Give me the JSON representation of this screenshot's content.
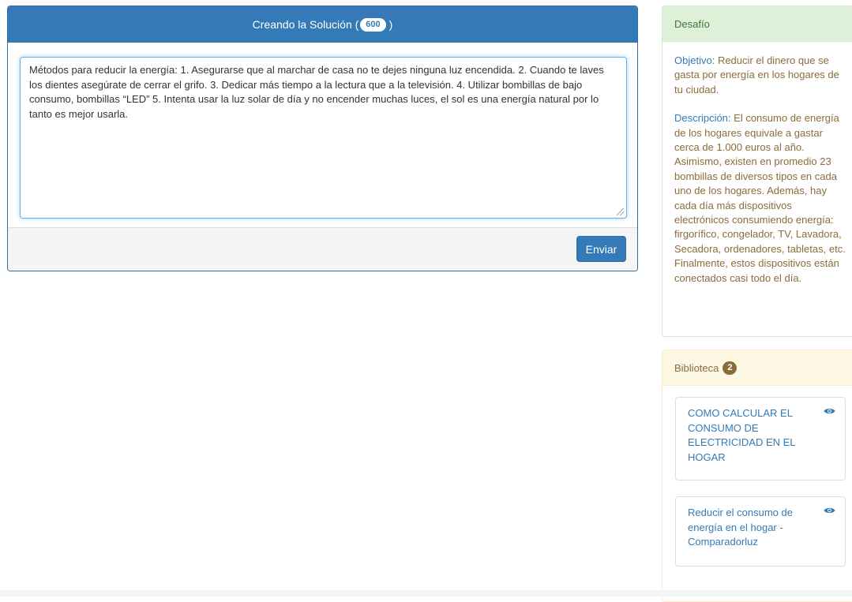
{
  "solution": {
    "header_prefix": "Creando la Solución (",
    "char_count": "600",
    "header_suffix": ")",
    "text": "Métodos para reducir la energía: 1. Asegurarse que al marchar de casa no te dejes ninguna luz encendida. 2. Cuando te laves los dientes asegúrate de cerrar el grifo. 3. Dedicar más tiempo a la lectura que a la televisión. 4. Utilizar bombillas de bajo consumo, bombillas “LED” 5. Intenta usar la luz solar de día y no encender muchas luces, el sol es una energía natural por lo tanto es mejor usarla.",
    "submit_label": "Enviar"
  },
  "challenge": {
    "title": "Desafío",
    "objective_label": "Objetivo:",
    "objective_text": "Reducir el dinero que se gasta por energía en los hogares de tu ciudad.",
    "description_label": "Descripción:",
    "description_text": "El consumo de energía de los hogares equivale a gastar cerca de 1.000 euros al año. Asimismo, existen en promedio 23 bombillas de diversos tipos en cada uno de los hogares. Además, hay cada día más dispositivos electrónicos consumiendo energía: firgorífico, congelador, TV, Lavadora, Secadora, ordenadores, tabletas, etc. Finalmente, estos dispositivos están conectados casi todo el día."
  },
  "library": {
    "title": "Biblioteca",
    "count": "2",
    "items": [
      {
        "title": "COMO CALCULAR EL CONSUMO DE ELECTRICIDAD EN EL HOGAR",
        "icon": "eye-icon"
      },
      {
        "title": "Reducir el consumo de energía en el hogar - Comparadorluz",
        "icon": "eye-icon"
      }
    ]
  },
  "colors": {
    "primary": "#337ab7",
    "success_bg": "#dff0d8",
    "warning_bg": "#fcf8e3",
    "warning_text": "#8a6d3b"
  }
}
